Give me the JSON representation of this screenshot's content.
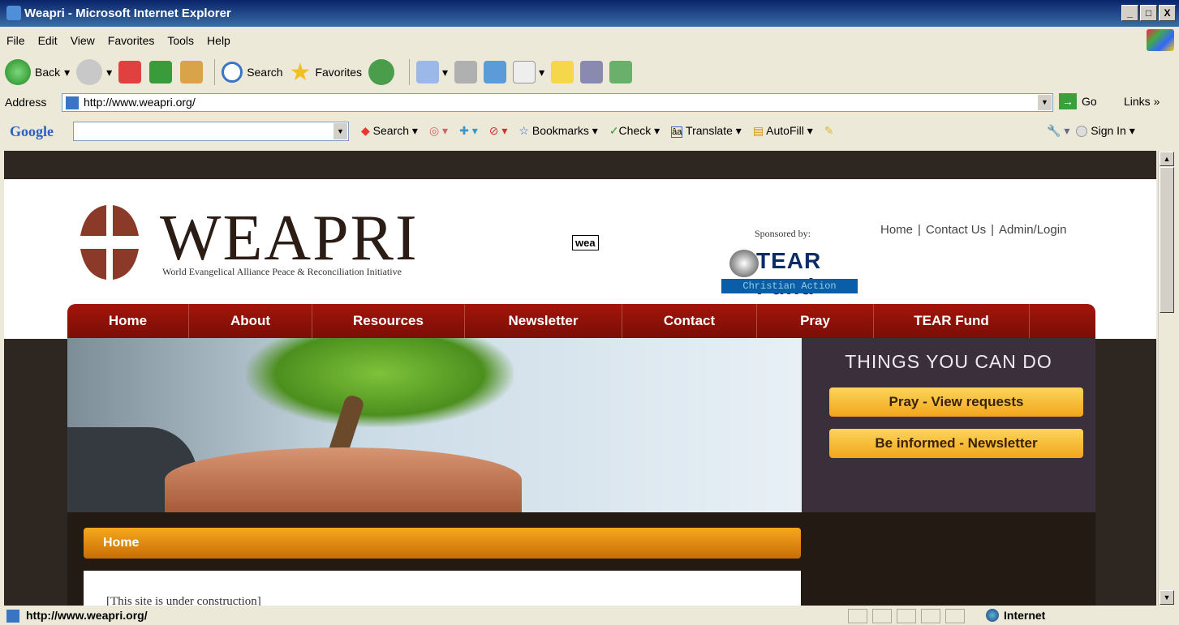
{
  "window": {
    "title": "Weapri - Microsoft Internet Explorer",
    "controls": [
      "_",
      "□",
      "X"
    ]
  },
  "menu": [
    "File",
    "Edit",
    "View",
    "Favorites",
    "Tools",
    "Help"
  ],
  "toolbar": {
    "back": "Back",
    "search": "Search",
    "favorites": "Favorites"
  },
  "address": {
    "label": "Address",
    "url": "http://www.weapri.org/",
    "go": "Go",
    "links": "Links"
  },
  "google": {
    "logo": "Google",
    "search": "Search",
    "bookmarks": "Bookmarks",
    "check": "Check",
    "translate": "Translate",
    "autofill": "AutoFill",
    "signin": "Sign In"
  },
  "site": {
    "logo_text": "WEAPRI",
    "logo_sub": "World Evangelical Alliance Peace & Reconciliation Initiative",
    "wea": "wea",
    "sponsored": "Sponsored by:",
    "tear_title": "TEAR Fund",
    "tear_band": "Christian Action",
    "top_links": [
      "Home",
      "|",
      "Contact Us",
      "|",
      "Admin/Login"
    ],
    "nav": [
      "Home",
      "About",
      "Resources",
      "Newsletter",
      "Contact",
      "Pray",
      "TEAR Fund"
    ],
    "things_title": "THINGS YOU CAN DO",
    "buttons": [
      "Pray - View requests",
      "Be informed - Newsletter"
    ],
    "section_title": "Home",
    "construction": "[This site is under construction]"
  },
  "status": {
    "url": "http://www.weapri.org/",
    "zone": "Internet"
  },
  "colors": {
    "nav_red": "#8e1208",
    "accent_orange": "#f2a51c",
    "dark_bg": "#2e2620",
    "things_bg": "#3b2f3c"
  }
}
